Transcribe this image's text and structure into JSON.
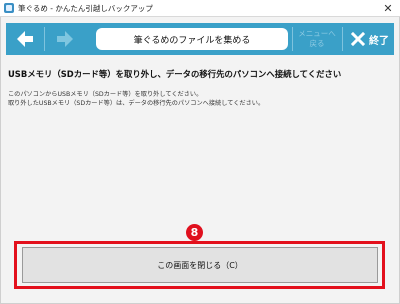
{
  "window": {
    "title": "筆ぐるめ - かんたん引越しバックアップ",
    "close_glyph": "✕"
  },
  "toolbar": {
    "back_icon": "arrow-left-icon",
    "forward_icon": "arrow-right-icon",
    "title": "筆ぐるめのファイルを集める",
    "menu_back_line1": "メニューへ",
    "menu_back_line2": "戻る",
    "exit_label": "終了",
    "bg_color": "#3aa0c8"
  },
  "main": {
    "heading": "USBメモリ（SDカード等）を取り外し、データの移行先のパソコンへ接続してください",
    "line1": "このパソコンからUSBメモリ（SDカード等）を取り外してください。",
    "line2": "取り外したUSBメモリ（SDカード等）は、データの移行先のパソコンへ接続してください。"
  },
  "callout": {
    "number": "8",
    "color": "#e3101c"
  },
  "footer": {
    "close_button_label": "この画面を閉じる（C）"
  }
}
